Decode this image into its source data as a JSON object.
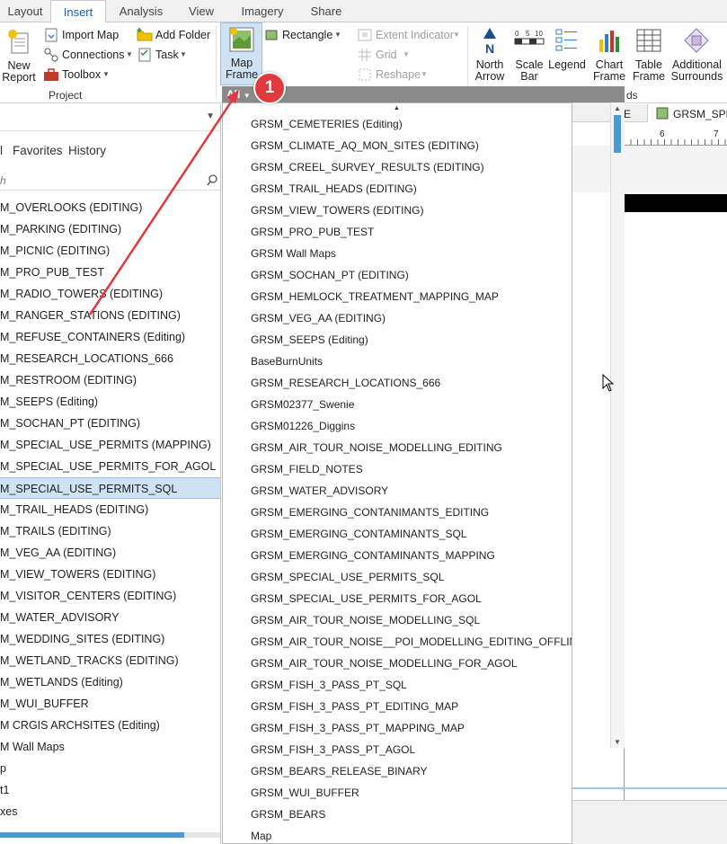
{
  "tabs": [
    {
      "label": "Layout",
      "active": false
    },
    {
      "label": "Insert",
      "active": true
    },
    {
      "label": "Analysis",
      "active": false
    },
    {
      "label": "View",
      "active": false
    },
    {
      "label": "Imagery",
      "active": false
    },
    {
      "label": "Share",
      "active": false
    }
  ],
  "ribbon": {
    "project": {
      "new_report": "New\nReport",
      "import_map": "Import Map",
      "connections": "Connections",
      "toolbox": "Toolbox",
      "add_folder": "Add Folder",
      "task": "Task",
      "group_label": "Project"
    },
    "map_frame": "Map\nFrame",
    "rectangle": "Rectangle",
    "extent_indicator": "Extent Indicator",
    "grid": "Grid",
    "reshape": "Reshape",
    "north_arrow": "North\nArrow",
    "scale_bar": "Scale\nBar",
    "legend": "Legend",
    "chart_frame": "Chart\nFrame",
    "table_frame": "Table\nFrame",
    "additional_surrounds": "Additional\nSurrounds",
    "group_label_partial": "ds"
  },
  "right_panel": {
    "tab_e": "E",
    "tab_spe": "GRSM_SPE",
    "ruler_6": "6",
    "ruler_7": "7"
  },
  "callout_number": "1",
  "left_pane": {
    "subtabs": [
      "l",
      "Favorites",
      "History"
    ],
    "search_placeholder": "h",
    "items": [
      "M_OVERLOOKS (EDITING)",
      "M_PARKING (EDITING)",
      "M_PICNIC (EDITING)",
      "M_PRO_PUB_TEST",
      "M_RADIO_TOWERS (EDITING)",
      "M_RANGER_STATIONS (EDITING)",
      "M_REFUSE_CONTAINERS (Editing)",
      "M_RESEARCH_LOCATIONS_666",
      "M_RESTROOM (EDITING)",
      "M_SEEPS (Editing)",
      "M_SOCHAN_PT (EDITING)",
      "M_SPECIAL_USE_PERMITS (MAPPING)",
      "M_SPECIAL_USE_PERMITS_FOR_AGOL",
      "M_SPECIAL_USE_PERMITS_SQL",
      "M_TRAIL_HEADS (EDITING)",
      "M_TRAILS (EDITING)",
      "M_VEG_AA (EDITING)",
      "M_VIEW_TOWERS (EDITING)",
      "M_VISITOR_CENTERS (EDITING)",
      "M_WATER_ADVISORY",
      "M_WEDDING_SITES (EDITING)",
      "M_WETLAND_TRACKS (EDITING)",
      "M_WETLANDS (Editing)",
      "M_WUI_BUFFER",
      "M CRGIS ARCHSITES (Editing)",
      "M Wall Maps",
      "p",
      "t1",
      "xes"
    ],
    "selected_index": 13
  },
  "dropdown": {
    "filter_label": "All",
    "items": [
      "GRSM_CEMETERIES (Editing)",
      "GRSM_CLIMATE_AQ_MON_SITES (EDITING)",
      "GRSM_CREEL_SURVEY_RESULTS (EDITING)",
      "GRSM_TRAIL_HEADS (EDITING)",
      "GRSM_VIEW_TOWERS (EDITING)",
      "GRSM_PRO_PUB_TEST",
      "GRSM Wall Maps",
      "GRSM_SOCHAN_PT (EDITING)",
      "GRSM_HEMLOCK_TREATMENT_MAPPING_MAP",
      "GRSM_VEG_AA (EDITING)",
      "GRSM_SEEPS (Editing)",
      "BaseBurnUnits",
      "GRSM_RESEARCH_LOCATIONS_666",
      "GRSM02377_Swenie",
      "GRSM01226_Diggins",
      "GRSM_AIR_TOUR_NOISE_MODELLING_EDITING",
      "GRSM_FIELD_NOTES",
      "GRSM_WATER_ADVISORY",
      "GRSM_EMERGING_CONTANIMANTS_EDITING",
      "GRSM_EMERGING_CONTAMINANTS_SQL",
      "GRSM_EMERGING_CONTAMINANTS_MAPPING",
      "GRSM_SPECIAL_USE_PERMITS_SQL",
      "GRSM_SPECIAL_USE_PERMITS_FOR_AGOL",
      "GRSM_AIR_TOUR_NOISE_MODELLING_SQL",
      "GRSM_AIR_TOUR_NOISE__POI_MODELLING_EDITING_OFFLINE",
      "GRSM_AIR_TOUR_NOISE_MODELLING_FOR_AGOL",
      "GRSM_FISH_3_PASS_PT_SQL",
      "GRSM_FISH_3_PASS_PT_EDITING_MAP",
      "GRSM_FISH_3_PASS_PT_MAPPING_MAP",
      "GRSM_FISH_3_PASS_PT_AGOL",
      "GRSM_BEARS_RELEASE_BINARY",
      "GRSM_WUI_BUFFER",
      "GRSM_BEARS",
      "Map"
    ]
  },
  "colors": {
    "accent": "#1a5fa8",
    "selected_row": "#cfe2f3",
    "callout": "#e0393e",
    "dropdown_header": "#8a8a8a"
  }
}
